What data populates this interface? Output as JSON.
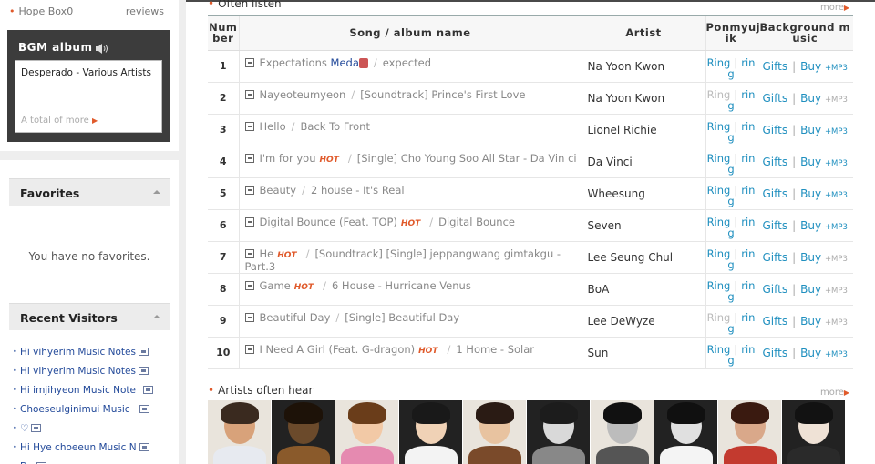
{
  "left": {
    "hope_box": "Hope Box0",
    "reviews": "reviews",
    "bgm": {
      "title": "BGM album",
      "song": "Desperado - Various Artists",
      "total": "A total of more"
    },
    "favorites": {
      "title": "Favorites",
      "empty": "You have no favorites."
    },
    "visitors": {
      "title": "Recent Visitors",
      "items": [
        "Hi vihyerim Music Notes",
        "Hi vihyerim Music Notes",
        "Hi imjihyeon Music Note",
        "Choeseulginimui Music",
        "♡",
        "Hi Hye choeeun Music N",
        "Do"
      ]
    }
  },
  "main": {
    "often_listen": {
      "title": "Often listen",
      "more": "more"
    },
    "columns": [
      "Num ber",
      "Song / album name",
      "Artist",
      "Ponmyuj ik",
      "Background m usic"
    ],
    "rows": [
      {
        "num": "1",
        "song": "Expectations",
        "meda": "Meda",
        "hot": "",
        "album": "expected",
        "artist": "Na Yoon Kwon",
        "ring1": "Ring",
        "ring2": "rin g",
        "ring_gray": false,
        "mp3_gray": false
      },
      {
        "num": "2",
        "song": "Nayeoteumyeon",
        "meda": "",
        "hot": "",
        "album": "[Soundtrack] Prince's First Love",
        "artist": "Na Yoon Kwon",
        "ring1": "Ring",
        "ring2": "rin g",
        "ring_gray": true,
        "mp3_gray": true
      },
      {
        "num": "3",
        "song": "Hello",
        "meda": "",
        "hot": "",
        "album": "Back To Front",
        "artist": "Lionel Richie",
        "ring1": "Ring",
        "ring2": "rin g",
        "ring_gray": false,
        "mp3_gray": false
      },
      {
        "num": "4",
        "song": "I'm for you",
        "meda": "",
        "hot": "HOT",
        "album": "[Single] Cho Young Soo All Star - Da Vin ci",
        "artist": "Da Vinci",
        "ring1": "Ring",
        "ring2": "rin g",
        "ring_gray": false,
        "mp3_gray": false
      },
      {
        "num": "5",
        "song": "Beauty",
        "meda": "",
        "hot": "",
        "album": "2 house - It's Real",
        "artist": "Wheesung",
        "ring1": "Ring",
        "ring2": "rin g",
        "ring_gray": false,
        "mp3_gray": false
      },
      {
        "num": "6",
        "song": "Digital Bounce (Feat. TOP)",
        "meda": "",
        "hot": "HOT",
        "album": "Digital Bounce",
        "artist": "Seven",
        "ring1": "Ring",
        "ring2": "rin g",
        "ring_gray": false,
        "mp3_gray": false
      },
      {
        "num": "7",
        "song": "He",
        "meda": "",
        "hot": "HOT",
        "album": "[Soundtrack] [Single] jeppangwang gimtakgu - Part.3",
        "artist": "Lee Seung Chul",
        "ring1": "Ring",
        "ring2": "rin g",
        "ring_gray": false,
        "mp3_gray": true
      },
      {
        "num": "8",
        "song": "Game",
        "meda": "",
        "hot": "HOT",
        "album": "6 House - Hurricane Venus",
        "artist": "BoA",
        "ring1": "Ring",
        "ring2": "rin g",
        "ring_gray": false,
        "mp3_gray": true
      },
      {
        "num": "9",
        "song": "Beautiful Day",
        "meda": "",
        "hot": "",
        "album": "[Single] Beautiful Day",
        "artist": "Lee DeWyze",
        "ring1": "Ring",
        "ring2": "rin g",
        "ring_gray": true,
        "mp3_gray": true
      },
      {
        "num": "10",
        "song": "I Need A Girl (Feat. G-dragon)",
        "meda": "",
        "hot": "HOT",
        "album": "1 Home - Solar",
        "artist": "Sun",
        "ring1": "Ring",
        "ring2": "rin g",
        "ring_gray": false,
        "mp3_gray": false
      }
    ],
    "gifts": "Gifts",
    "buy": "Buy",
    "mp3": "+MP3",
    "artists": {
      "title": "Artists often hear",
      "more": "more"
    },
    "thumb_colors": [
      [
        "#d8a27a",
        "#3a2a1f",
        "#e7eaf0"
      ],
      [
        "#6b4a2b",
        "#1d1208",
        "#8a5a2b"
      ],
      [
        "#f2c9a6",
        "#6a3d1a",
        "#e58ab0"
      ],
      [
        "#f0d2b6",
        "#191919",
        "#f3f3f3"
      ],
      [
        "#e8c3a0",
        "#2a1b14",
        "#7a4a2a"
      ],
      [
        "#d9d9d9",
        "#1c1c1c",
        "#888888"
      ],
      [
        "#bcbcbc",
        "#111111",
        "#555555"
      ],
      [
        "#e0e0e0",
        "#101010",
        "#f4f4f4"
      ],
      [
        "#d9a88a",
        "#3a1a10",
        "#c33a2f"
      ],
      [
        "#efe2d6",
        "#121212",
        "#2a2a2a"
      ]
    ]
  },
  "colors": {
    "accent": "#e05a2b",
    "link": "#1f8fbf",
    "dark_panel": "#3c3c3c"
  }
}
